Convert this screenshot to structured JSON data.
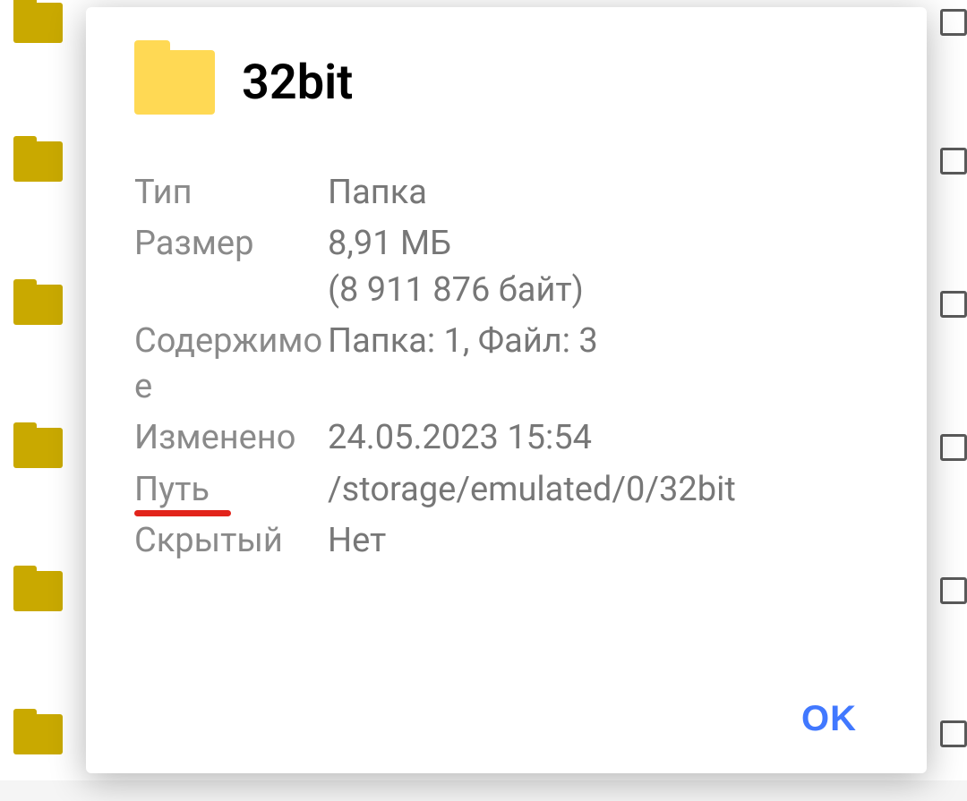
{
  "dialog": {
    "title": "32bit",
    "props": {
      "type_label": "Тип",
      "type_value": "Папка",
      "size_label": "Размер",
      "size_value": "8,91 МБ",
      "size_bytes": "(8 911 876 байт)",
      "contents_label": "Содержимое",
      "contents_value": "Папка: 1, Файл: 3",
      "modified_label": "Изменено",
      "modified_value": "24.05.2023 15:54",
      "path_label": "Путь",
      "path_value": "/storage/emulated/0/32bit",
      "hidden_label": "Скрытый",
      "hidden_value": "Нет"
    },
    "ok_label": "OK"
  }
}
